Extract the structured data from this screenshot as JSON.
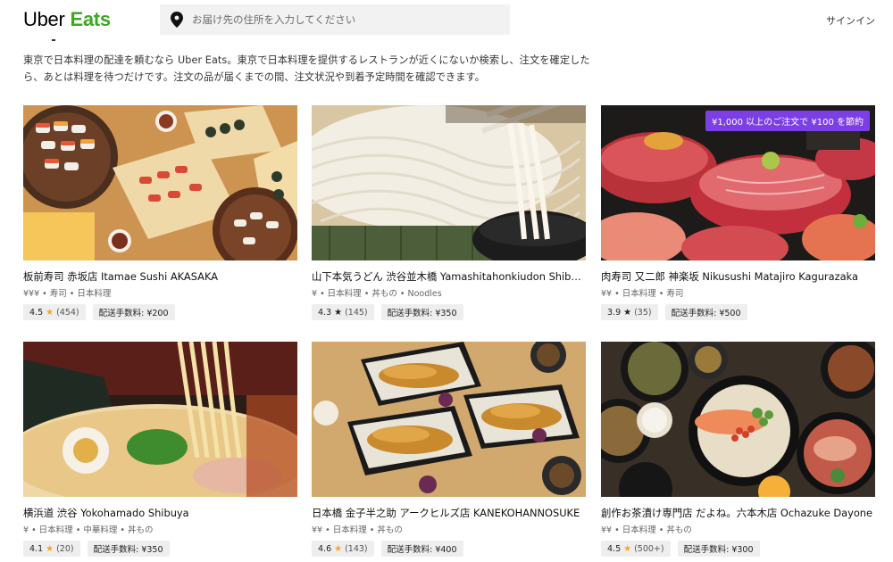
{
  "brand": {
    "word1": "Uber",
    "word2": "Eats",
    "accent": "#3fa628"
  },
  "search": {
    "placeholder": "お届け先の住所を入力してください",
    "icon": "location-pin-icon"
  },
  "header": {
    "signin": "サインイン"
  },
  "intro": {
    "text": "東京で日本料理の配達を頼むなら Uber Eats。東京で日本料理を提供するレストランが近くにないか検索し、注文を確定したら、あとは料理を待つだけです。注文の品が届くまでの間、注文状況や到着予定時間を確認できます。"
  },
  "restaurants": [
    {
      "name": "板前寿司 赤坂店 Itamae Sushi AKASAKA",
      "categories": "¥¥¥ • 寿司 • 日本料理",
      "rating": "4.5",
      "star_color": "#f5a623",
      "reviews": "(454)",
      "fee": "配送手数料: ¥200",
      "promo": ""
    },
    {
      "name": "山下本気うどん 渋谷並木橋 Yamashitahonkiudon Shibu...",
      "categories": "¥ • 日本料理 • 丼もの • Noodles",
      "rating": "4.3",
      "star_color": "#222222",
      "reviews": "(145)",
      "fee": "配送手数料: ¥350",
      "promo": ""
    },
    {
      "name": "肉寿司 又二郎 神楽坂 Nikusushi Matajiro Kagurazaka",
      "categories": "¥¥ • 日本料理 • 寿司",
      "rating": "3.9",
      "star_color": "#222222",
      "reviews": "(35)",
      "fee": "配送手数料: ¥500",
      "promo": "¥1,000 以上のご注文で ¥100 を節約"
    },
    {
      "name": "横浜道 渋谷 Yokohamado Shibuya",
      "categories": "¥ • 日本料理 • 中華料理 • 丼もの",
      "rating": "4.1",
      "star_color": "#f5a623",
      "reviews": "(20)",
      "fee": "配送手数料: ¥350",
      "promo": ""
    },
    {
      "name": "日本橋 金子半之助 アークヒルズ店 KANEKOHANNOSUKE",
      "categories": "¥¥ • 日本料理 • 丼もの",
      "rating": "4.6",
      "star_color": "#f5a623",
      "reviews": "(143)",
      "fee": "配送手数料: ¥400",
      "promo": ""
    },
    {
      "name": "創作お茶漬け専門店 だよね。六本木店 Ochazuke Dayone",
      "categories": "¥¥ • 日本料理 • 丼もの",
      "rating": "4.5",
      "star_color": "#f5a623",
      "reviews": "(500+)",
      "fee": "配送手数料: ¥300",
      "promo": ""
    }
  ]
}
